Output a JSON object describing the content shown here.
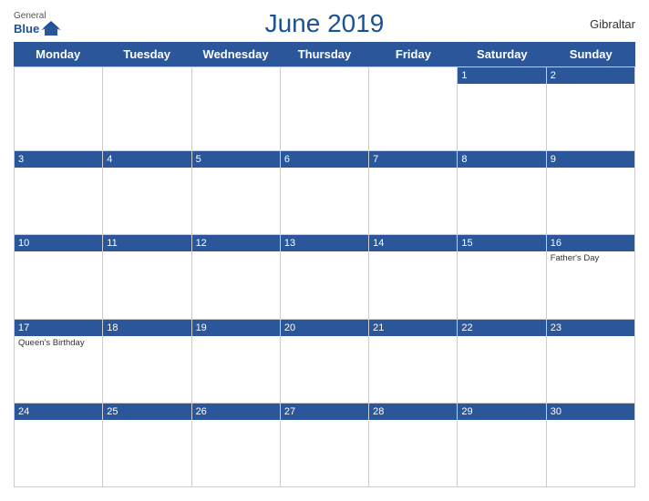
{
  "header": {
    "title": "June 2019",
    "location": "Gibraltar",
    "logo_general": "General",
    "logo_blue": "Blue"
  },
  "dayHeaders": [
    "Monday",
    "Tuesday",
    "Wednesday",
    "Thursday",
    "Friday",
    "Saturday",
    "Sunday"
  ],
  "weeks": [
    [
      {
        "date": "",
        "event": ""
      },
      {
        "date": "",
        "event": ""
      },
      {
        "date": "",
        "event": ""
      },
      {
        "date": "",
        "event": ""
      },
      {
        "date": "",
        "event": ""
      },
      {
        "date": "1",
        "event": ""
      },
      {
        "date": "2",
        "event": ""
      }
    ],
    [
      {
        "date": "3",
        "event": ""
      },
      {
        "date": "4",
        "event": ""
      },
      {
        "date": "5",
        "event": ""
      },
      {
        "date": "6",
        "event": ""
      },
      {
        "date": "7",
        "event": ""
      },
      {
        "date": "8",
        "event": ""
      },
      {
        "date": "9",
        "event": ""
      }
    ],
    [
      {
        "date": "10",
        "event": ""
      },
      {
        "date": "11",
        "event": ""
      },
      {
        "date": "12",
        "event": ""
      },
      {
        "date": "13",
        "event": ""
      },
      {
        "date": "14",
        "event": ""
      },
      {
        "date": "15",
        "event": ""
      },
      {
        "date": "16",
        "event": "Father's Day"
      }
    ],
    [
      {
        "date": "17",
        "event": "Queen's Birthday"
      },
      {
        "date": "18",
        "event": ""
      },
      {
        "date": "19",
        "event": ""
      },
      {
        "date": "20",
        "event": ""
      },
      {
        "date": "21",
        "event": ""
      },
      {
        "date": "22",
        "event": ""
      },
      {
        "date": "23",
        "event": ""
      }
    ],
    [
      {
        "date": "24",
        "event": ""
      },
      {
        "date": "25",
        "event": ""
      },
      {
        "date": "26",
        "event": ""
      },
      {
        "date": "27",
        "event": ""
      },
      {
        "date": "28",
        "event": ""
      },
      {
        "date": "29",
        "event": ""
      },
      {
        "date": "30",
        "event": ""
      }
    ]
  ],
  "colors": {
    "blue": "#2b579a",
    "text": "#333333",
    "border": "#cccccc"
  }
}
